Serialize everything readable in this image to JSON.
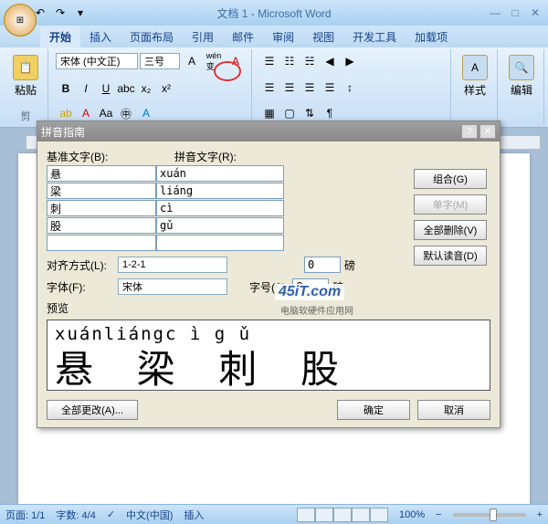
{
  "app": {
    "title": "文档 1 - Microsoft Word"
  },
  "tabs": [
    "开始",
    "插入",
    "页面布局",
    "引用",
    "邮件",
    "审阅",
    "视图",
    "开发工具",
    "加载项"
  ],
  "ribbon": {
    "paste_label": "粘贴",
    "clipboard_label": "剪",
    "font_name": "宋体 (中文正)",
    "font_size": "三号",
    "styles_label": "样式",
    "editing_label": "编辑"
  },
  "dialog": {
    "title": "拼音指南",
    "base_label": "基准文字(B):",
    "ruby_label": "拼音文字(R):",
    "rows": [
      {
        "base": "悬",
        "ruby": "xuán"
      },
      {
        "base": "梁",
        "ruby": "liáng"
      },
      {
        "base": "刺",
        "ruby": "cì"
      },
      {
        "base": "股",
        "ruby": "gǔ"
      }
    ],
    "btn_group": "组合(G)",
    "btn_single": "单字(M)",
    "btn_clearall": "全部删除(V)",
    "btn_default": "默认读音(D)",
    "align_label": "对齐方式(L):",
    "align_value": "1-2-1",
    "offset_value": "0",
    "offset_unit": "磅",
    "font_label": "字体(F):",
    "font_value": "宋体",
    "fontsize_label": "字号(S):",
    "fontsize_value": "8",
    "fontsize_unit": "磅",
    "preview_label": "预览",
    "preview_ruby": "xuánliángc ì g ǔ",
    "preview_base": "悬 梁 刺 股",
    "btn_changeall": "全部更改(A)...",
    "btn_ok": "确定",
    "btn_cancel": "取消"
  },
  "watermark": {
    "main": "45iT.com",
    "sub": "电脑软硬件应用网"
  },
  "status": {
    "page": "页面: 1/1",
    "words": "字数: 4/4",
    "lang": "中文(中国)",
    "mode": "插入",
    "zoom": "100%"
  }
}
